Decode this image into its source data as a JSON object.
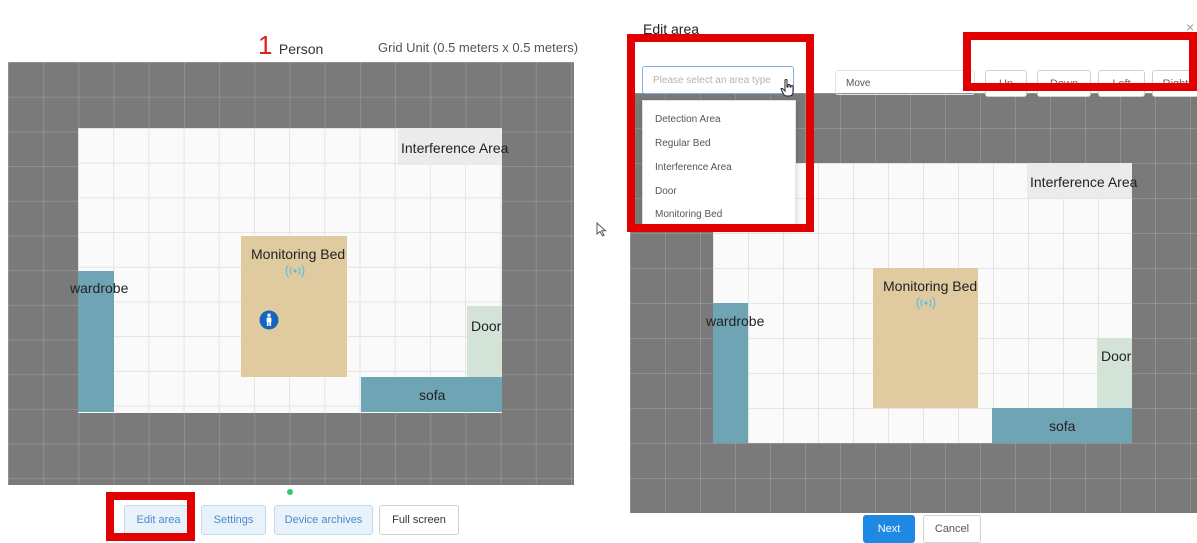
{
  "left_panel": {
    "person_count": "1",
    "person_label": "Person",
    "grid_unit": "Grid Unit (0.5 meters x 0.5 meters)",
    "zones": {
      "interference": "Interference Area",
      "monitoring_bed": "Monitoring Bed",
      "wardrobe": "wardrobe",
      "door": "Door",
      "sofa": "sofa"
    },
    "status_dot_color": "#2ecc71",
    "buttons": {
      "edit_area": "Edit area",
      "settings": "Settings",
      "device_archives": "Device archives",
      "full_screen": "Full screen"
    }
  },
  "edit_dialog": {
    "title": "Edit area",
    "close": "×",
    "area_type_select": {
      "placeholder": "Please select an area type",
      "options": [
        "Detection Area",
        "Regular Bed",
        "Interference Area",
        "Door",
        "Monitoring Bed"
      ]
    },
    "move_label": "Move",
    "move_buttons": {
      "up": "Up",
      "down": "Down",
      "left": "Left",
      "right": "Right"
    },
    "zones": {
      "interference": "Interference Area",
      "monitoring_bed": "Monitoring Bed",
      "wardrobe": "wardrobe",
      "door": "Door",
      "sofa": "sofa"
    },
    "footer": {
      "next": "Next",
      "cancel": "Cancel"
    }
  },
  "colors": {
    "highlight_frame": "#e30000",
    "primary_button": "#1e88e5",
    "zone_teal": "#6fa4b4",
    "zone_bed": "#e0caa0",
    "wifi_icon": "#5bc0de",
    "person_icon": "#1565c0"
  },
  "icons": [
    "wifi-signal-icon",
    "person-icon",
    "hand-cursor-icon",
    "arrow-cursor-icon",
    "close-icon"
  ]
}
